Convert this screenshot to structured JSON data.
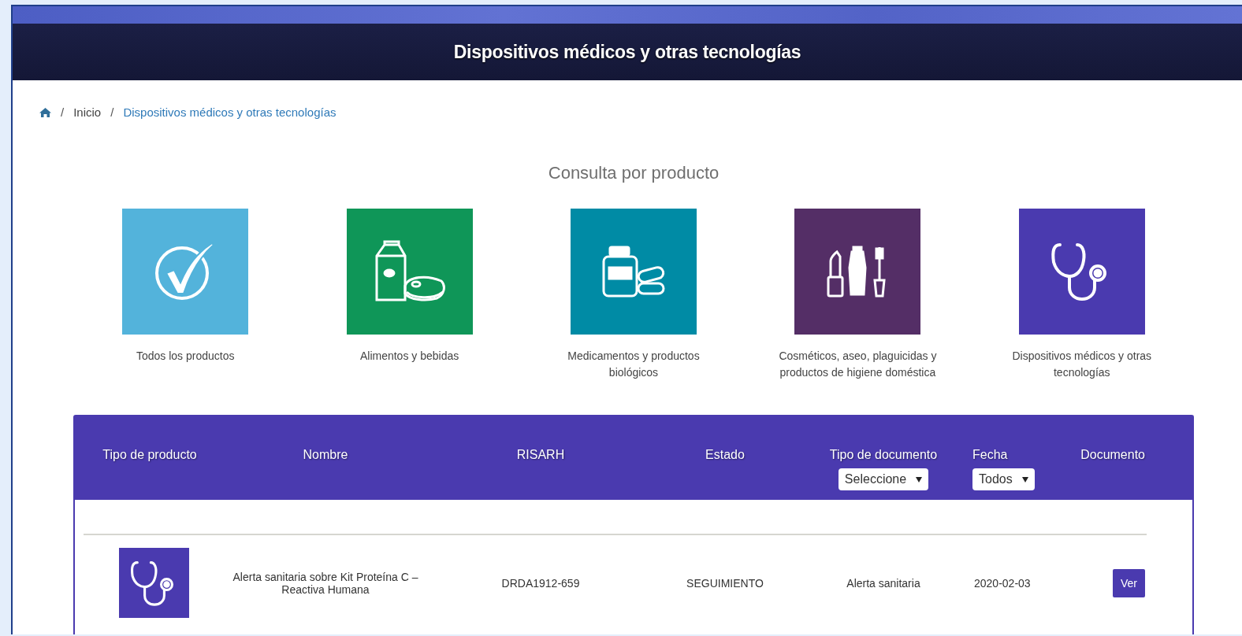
{
  "header": {
    "title": "Dispositivos médicos y otras tecnologías"
  },
  "breadcrumb": [
    {
      "kind": "home"
    },
    {
      "kind": "separator",
      "label": "/"
    },
    {
      "kind": "link",
      "label": "Inicio"
    },
    {
      "kind": "separator",
      "label": "/"
    },
    {
      "kind": "current",
      "label": "Dispositivos médicos y otras tecnologías"
    }
  ],
  "categories_title": "Consulta por producto",
  "categories": [
    {
      "kind": "all",
      "label": "Todos los productos",
      "color": "#53b3db"
    },
    {
      "kind": "food",
      "label": "Alimentos y bebidas",
      "color": "#0f9658"
    },
    {
      "kind": "medicine",
      "label": "Medicamentos y productos biológicos",
      "color": "#008ba5"
    },
    {
      "kind": "cosmetics",
      "label": "Cosméticos, aseo, plaguicidas y productos de higiene doméstica",
      "color": "#542e66"
    },
    {
      "kind": "devices",
      "label": "Dispositivos médicos y otras tecnologías",
      "color": "#4a3aaf"
    }
  ],
  "table": {
    "columns": [
      {
        "label": "Tipo de producto"
      },
      {
        "label": "Nombre"
      },
      {
        "label": "RISARH"
      },
      {
        "label": "Estado"
      },
      {
        "label": "Tipo de documento",
        "filter": "Seleccione"
      },
      {
        "label": "Fecha",
        "filter": "Todos"
      },
      {
        "label": "Documento"
      }
    ],
    "rows": [
      {
        "kind": "devices",
        "name": "Alerta sanitaria sobre Kit Proteína C – Reactiva Humana",
        "risarh": "DRDA1912-659",
        "estado": "SEGUIMIENTO",
        "tipo_documento": "Alerta sanitaria",
        "fecha": "2020-02-03",
        "action": "Ver"
      }
    ]
  }
}
